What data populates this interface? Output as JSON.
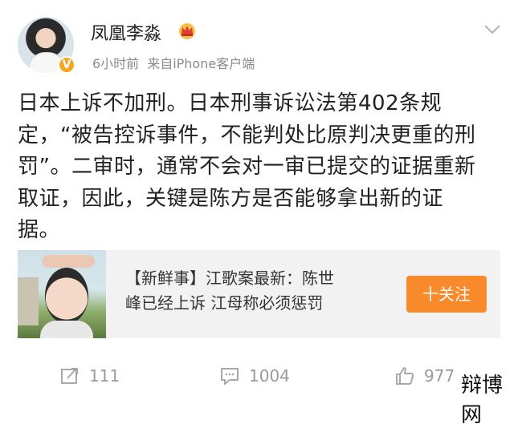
{
  "post": {
    "author": "凤凰李淼",
    "verified_mark": "V",
    "time": "6小时前",
    "source": "来自iPhone客户端",
    "text_lines": [
      "日本上诉不加刑。日本刑事诉讼法第402条规",
      "定，“被告控诉事件，不能判处比原判决更重的刑",
      "罚”。二审时，通常不会对一审已提交的证据重新",
      "取证，因此，关键是陈方是否能够拿出新的证",
      "据。"
    ]
  },
  "card": {
    "title_line1": "【新鲜事】江歌案最新：陈世",
    "title_line2": "峰已经上诉 江母称必须惩罚",
    "follow_label": "十关注"
  },
  "actions": {
    "repost_count": "111",
    "comment_count": "1004",
    "like_count": "977"
  },
  "icons": {
    "crown": "crown-icon",
    "menu": "chevron-down-icon",
    "repost": "repost-icon",
    "comment": "comment-icon",
    "like": "thumbs-up-icon"
  },
  "colors": {
    "follow_button": "#f98a2b",
    "verified_badge": "#f5a623",
    "meta_text": "#8a8a8a"
  },
  "watermark": "辩博网"
}
